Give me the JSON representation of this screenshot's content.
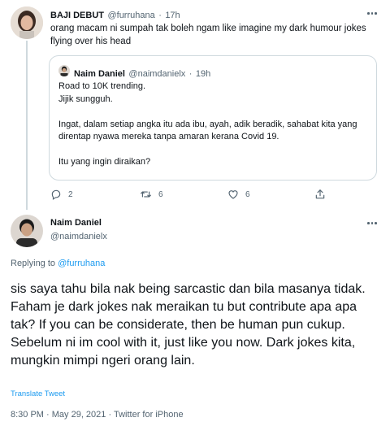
{
  "parent_tweet": {
    "display_name": "BAJI DEBUT",
    "handle": "@furruhana",
    "separator": "·",
    "time": "17h",
    "text": "orang macam ni sumpah tak boleh ngam like imagine my dark humour jokes flying over his head"
  },
  "quoted_tweet": {
    "display_name": "Naim Daniel",
    "handle": "@naimdanielx",
    "separator": "·",
    "time": "19h",
    "text": "Road to 10K trending.\nJijik sungguh.\n\nIngat, dalam setiap angka itu ada ibu, ayah, adik beradik, sahabat kita yang direntap nyawa mereka tanpa amaran kerana Covid 19.\n\nItu yang ingin diraikan?"
  },
  "parent_actions": {
    "reply_count": "2",
    "retweet_count": "6",
    "like_count": "6"
  },
  "main_tweet": {
    "display_name": "Naim Daniel",
    "handle": "@naimdanielx",
    "replying_to_prefix": "Replying to ",
    "replying_to_handle": "@furruhana",
    "text": "sis saya tahu bila nak being sarcastic dan bila masanya tidak. Faham je dark jokes nak meraikan tu but contribute apa apa tak? If you can be considerate, then be human pun cukup. Sebelum ni im cool with it, just like you now. Dark jokes kita, mungkin mimpi ngeri orang lain.",
    "translate_label": "Translate Tweet",
    "timestamp": "8:30 PM · May 29, 2021 · Twitter for iPhone"
  },
  "icons": [
    "more-icon",
    "reply-icon",
    "retweet-icon",
    "like-icon",
    "share-icon"
  ],
  "colors": {
    "link": "#1d9bf0",
    "muted": "#536471",
    "border": "#cfd9de",
    "text": "#0f1419"
  }
}
